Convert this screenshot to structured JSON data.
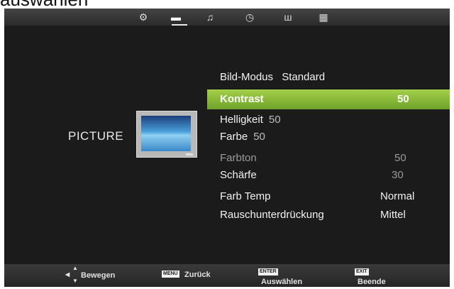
{
  "caption": "auswählen",
  "tabs": [
    {
      "name": "settings-icon",
      "glyph": "⚙"
    },
    {
      "name": "picture-icon",
      "glyph": "▬"
    },
    {
      "name": "music-icon",
      "glyph": "♫"
    },
    {
      "name": "clock-icon",
      "glyph": "◷"
    },
    {
      "name": "lock-icon",
      "glyph": "ш"
    },
    {
      "name": "grid-icon",
      "glyph": "▦"
    }
  ],
  "section": {
    "label": "PICTURE"
  },
  "menu": {
    "mode": {
      "label": "Bild-Modus",
      "value": "Standard"
    },
    "contrast": {
      "label": "Kontrast",
      "value": "50"
    },
    "brightness": {
      "label": "Helligkeit",
      "value": "50"
    },
    "color": {
      "label": "Farbe",
      "value": "50"
    },
    "tint": {
      "label": "Farbton",
      "value": "50"
    },
    "sharpness": {
      "label": "Schärfe",
      "value": "30"
    },
    "color_temp": {
      "label": "Farb Temp",
      "value": "Normal"
    },
    "noise": {
      "label": "Rauschunterdrückung",
      "value": "Mittel"
    }
  },
  "footer": {
    "move": {
      "label": "Bewegen"
    },
    "back": {
      "key": "MENU",
      "label": "Zurück"
    },
    "select": {
      "key": "ENTER",
      "label": "Auswählen"
    },
    "exit": {
      "key": "EXIT",
      "label": "Beende"
    }
  },
  "colors": {
    "highlight": "#8dbb3a",
    "background": "#1b1b1b"
  }
}
